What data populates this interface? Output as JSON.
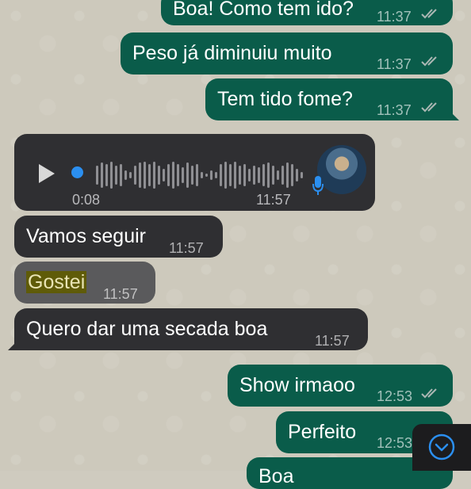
{
  "messages": {
    "m1": {
      "text": "Boa! Como tem ido?",
      "time": "11:37"
    },
    "m2": {
      "text": "Peso já diminuiu muito",
      "time": "11:37"
    },
    "m3": {
      "text": "Tem tido fome?",
      "time": "11:37"
    },
    "voice": {
      "elapsed": "0:08",
      "time": "11:57"
    },
    "m5": {
      "text": "Vamos seguir",
      "time": "11:57"
    },
    "m6": {
      "text": "Gostei",
      "time": "11:57"
    },
    "m7": {
      "text": "Quero dar uma secada boa",
      "time": "11:57"
    },
    "m8": {
      "text": "Show irmaoo",
      "time": "12:53"
    },
    "m9": {
      "text": "Perfeito",
      "time": "12:53"
    },
    "m10": {
      "text": "Boa"
    }
  },
  "colors": {
    "outgoing_bubble": "#0a5c4a",
    "incoming_bubble": "#2f2f32",
    "accent_blue": "#2b8ff0",
    "read_ticks": "#aab7b3"
  },
  "icons": [
    "play-icon",
    "mic-icon",
    "double-check-icon",
    "chevron-down-icon"
  ]
}
